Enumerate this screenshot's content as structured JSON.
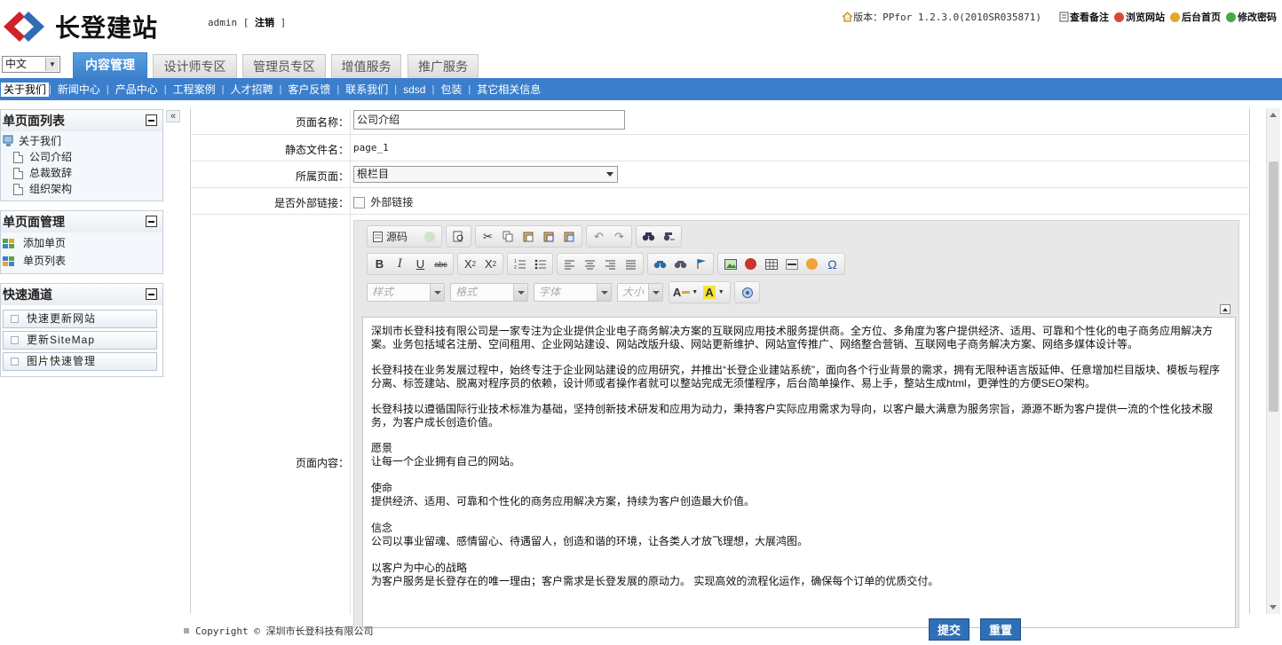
{
  "brand": {
    "name": "长登建站"
  },
  "user": {
    "name": "admin",
    "logout": "注销",
    "open": "[",
    "close": "]"
  },
  "topright": {
    "version": "版本：PPfor 1.2.3.0(2010SR035871)",
    "links": [
      "查看备注",
      "浏览网站",
      "后台首页",
      "修改密码"
    ]
  },
  "lang": {
    "selected": "中文"
  },
  "tabs": [
    "内容管理",
    "设计师专区",
    "管理员专区",
    "增值服务",
    "推广服务"
  ],
  "subnav": [
    "关于我们",
    "新闻中心",
    "产品中心",
    "工程案例",
    "人才招聘",
    "客户反馈",
    "联系我们",
    "sdsd",
    "包装",
    "其它相关信息"
  ],
  "sidebar": {
    "list": {
      "title": "单页面列表",
      "root": "关于我们",
      "children": [
        "公司介绍",
        "总裁致辞",
        "组织架构"
      ]
    },
    "manage": {
      "title": "单页面管理",
      "items": [
        "添加单页",
        "单页列表"
      ]
    },
    "quick": {
      "title": "快速通道",
      "items": [
        "快速更新网站",
        "更新SiteMap",
        "图片快速管理"
      ]
    }
  },
  "form": {
    "name_label": "页面名称：",
    "name_value": "公司介绍",
    "static_label": "静态文件名：",
    "static_value": "page_1",
    "parent_label": "所属页面：",
    "parent_value": "根栏目",
    "external_label": "是否外部链接：",
    "external_text": "外部链接",
    "content_label": "页面内容："
  },
  "editor": {
    "source_label": "源码",
    "combos": [
      "样式",
      "格式",
      "字体",
      "大小"
    ],
    "content": {
      "p1": "深圳市长登科技有限公司是一家专注为企业提供企业电子商务解决方案的互联网应用技术服务提供商。全方位、多角度为客户提供经济、适用、可靠和个性化的电子商务应用解决方案。业务包括域名注册、空间租用、企业网站建设、网站改版升级、网站更新维护、网站宣传推广、网络整合营销、互联网电子商务解决方案、网络多媒体设计等。",
      "p2": "长登科技在业务发展过程中，始终专注于企业网站建设的应用研究，并推出“长登企业建站系统”，面向各个行业背景的需求，拥有无限种语言版延伸、任意增加栏目版块、模板与程序分离、标签建站、脱离对程序员的依赖，设计师或者操作者就可以整站完成无须懂程序，后台简单操作、易上手，整站生成html，更弹性的方便SEO架构。",
      "p3": "长登科技以遵循国际行业技术标准为基础，坚持创新技术研发和应用为动力，秉持客户实际应用需求为导向，以客户最大满意为服务宗旨，源源不断为客户提供一流的个性化技术服务，为客户成长创造价值。",
      "vision_title": "愿景",
      "vision": "让每一个企业拥有自己的网站。",
      "mission_title": "使命",
      "mission": "提供经济、适用、可靠和个性化的商务应用解决方案，持续为客户创造最大价值。",
      "belief_title": "信念",
      "belief": "公司以事业留魂、感情留心、待遇留人，创造和谐的环境，让各类人才放飞理想，大展鸿图。",
      "strategy_title": "以客户为中心的战略",
      "strategy": "为客户服务是长登存在的唯一理由；客户需求是长登发展的原动力。 实现高效的流程化运作，确保每个订单的优质交付。"
    }
  },
  "footer": {
    "copyright": "Copyright © 深圳市长登科技有限公司"
  },
  "buttons": {
    "submit": "提交",
    "reset": "重置"
  },
  "colors": {
    "accent": "#3b7fcc",
    "logo_red": "#d0222a",
    "logo_blue": "#2e6db4"
  }
}
